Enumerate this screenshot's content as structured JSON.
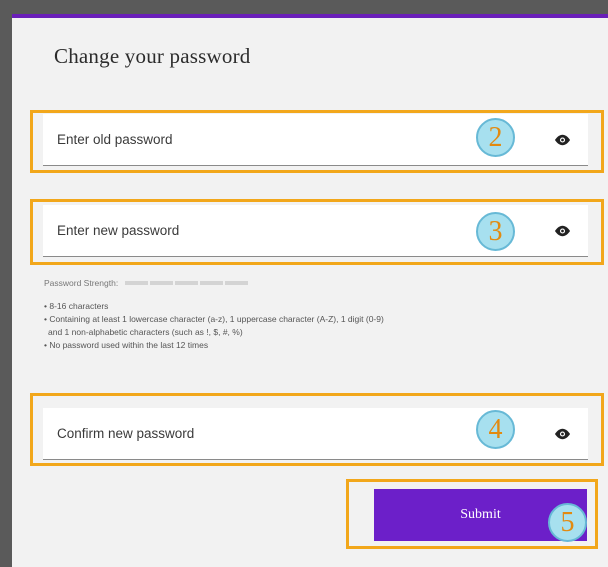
{
  "form": {
    "title": "Change your password",
    "fields": [
      {
        "placeholder": "Enter old password",
        "icon": "eye-icon"
      },
      {
        "placeholder": "Enter new password",
        "icon": "eye-icon"
      },
      {
        "placeholder": "Confirm new password",
        "icon": "eye-icon"
      }
    ],
    "strength_label": "Password Strength:",
    "rules": [
      "• 8-16 characters",
      "• Containing at least 1 lowercase character (a-z), 1 uppercase character (A-Z), 1 digit (0-9)",
      "   and 1 non-alphabetic characters  (such as !, $, #, %)",
      "• No password used within the last 12 times"
    ],
    "submit_label": "Submit"
  },
  "annotations": {
    "badges": [
      "2",
      "3",
      "4",
      "5"
    ],
    "highlight_color": "#f2a71b",
    "badge_fill": "#a7e0ef"
  },
  "colors": {
    "accent": "#6c1fc9",
    "background": "#5a5a5a",
    "card": "#f2f2f2"
  }
}
